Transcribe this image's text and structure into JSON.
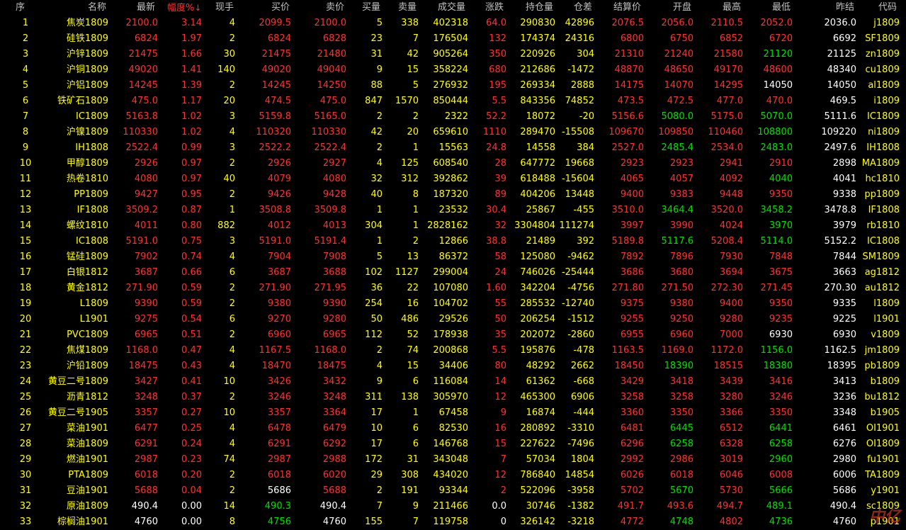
{
  "headers": {
    "seq": "序",
    "name": "名称",
    "latest": "最新",
    "change_pct": "幅度%",
    "sort_arrow": "↓",
    "cur_vol": "现手",
    "bid": "买价",
    "ask": "卖价",
    "bid_vol": "买量",
    "ask_vol": "卖量",
    "volume": "成交量",
    "change": "涨跌",
    "open_interest": "持仓量",
    "oi_change": "仓差",
    "settle": "结算价",
    "open": "开盘",
    "high": "最高",
    "low": "最低",
    "prev_settle": "昨结",
    "code": "代码"
  },
  "colors": {
    "up": "#ff3232",
    "down": "#00e000",
    "flat": "#ffffff",
    "text_yellow": "#ffff00"
  },
  "watermark": "中亿",
  "rows": [
    [
      "1",
      "焦炭1809",
      "2100.0",
      "3.14",
      "4",
      "2099.5",
      "2100.0",
      "5",
      "338",
      "402318",
      "64.0",
      "290830",
      "42896",
      "2076.5",
      "2056.0",
      "2110.5",
      "2052.0",
      "2036.0",
      "j1809"
    ],
    [
      "2",
      "硅铁1809",
      "6824",
      "1.97",
      "2",
      "6824",
      "6828",
      "23",
      "7",
      "176504",
      "132",
      "174374",
      "24316",
      "6800",
      "6750",
      "6852",
      "6720",
      "6692",
      "SF1809"
    ],
    [
      "3",
      "沪锌1809",
      "21475",
      "1.66",
      "30",
      "21475",
      "21480",
      "31",
      "42",
      "905264",
      "350",
      "220926",
      "304",
      "21310",
      "21240",
      "21580",
      "21120",
      "21125",
      "zn1809"
    ],
    [
      "4",
      "沪铜1809",
      "49020",
      "1.41",
      "140",
      "49020",
      "49040",
      "9",
      "15",
      "358224",
      "680",
      "212686",
      "-1472",
      "48870",
      "48650",
      "49170",
      "48600",
      "48340",
      "cu1809"
    ],
    [
      "5",
      "沪铝1809",
      "14245",
      "1.39",
      "2",
      "14245",
      "14250",
      "88",
      "5",
      "276932",
      "195",
      "269334",
      "2888",
      "14175",
      "14070",
      "14295",
      "14050",
      "14050",
      "al1809"
    ],
    [
      "6",
      "铁矿石1809",
      "475.0",
      "1.17",
      "20",
      "474.5",
      "475.0",
      "847",
      "1570",
      "850444",
      "5.5",
      "843356",
      "74852",
      "473.5",
      "472.5",
      "477.0",
      "470.0",
      "469.5",
      "i1809"
    ],
    [
      "7",
      "IC1809",
      "5163.8",
      "1.02",
      "3",
      "5159.8",
      "5165.0",
      "2",
      "2",
      "2322",
      "52.2",
      "18072",
      "-20",
      "5156.6",
      "5080.0",
      "5175.0",
      "5070.0",
      "5111.6",
      "IC1809"
    ],
    [
      "8",
      "沪镍1809",
      "110330",
      "1.02",
      "4",
      "110320",
      "110330",
      "42",
      "20",
      "659610",
      "1110",
      "289470",
      "-15508",
      "109670",
      "109850",
      "110460",
      "108800",
      "109220",
      "ni1809"
    ],
    [
      "9",
      "IH1808",
      "2522.4",
      "0.99",
      "3",
      "2522.2",
      "2522.4",
      "2",
      "1",
      "15563",
      "24.8",
      "14558",
      "384",
      "2527.0",
      "2485.4",
      "2534.0",
      "2483.0",
      "2497.6",
      "IH1808"
    ],
    [
      "10",
      "甲醇1809",
      "2926",
      "0.97",
      "2",
      "2926",
      "2927",
      "4",
      "125",
      "608540",
      "28",
      "647772",
      "19668",
      "2923",
      "2923",
      "2941",
      "2910",
      "2898",
      "MA1809"
    ],
    [
      "11",
      "热卷1810",
      "4080",
      "0.97",
      "40",
      "4079",
      "4080",
      "32",
      "312",
      "392862",
      "39",
      "618488",
      "-15604",
      "4065",
      "4057",
      "4092",
      "4040",
      "4041",
      "hc1810"
    ],
    [
      "12",
      "PP1809",
      "9427",
      "0.95",
      "2",
      "9426",
      "9428",
      "40",
      "8",
      "187320",
      "89",
      "404206",
      "13448",
      "9400",
      "9383",
      "9448",
      "9350",
      "9338",
      "pp1809"
    ],
    [
      "13",
      "IF1808",
      "3509.2",
      "0.87",
      "1",
      "3508.8",
      "3509.8",
      "1",
      "1",
      "23532",
      "30.4",
      "25867",
      "-455",
      "3510.0",
      "3464.4",
      "3520.0",
      "3458.2",
      "3478.8",
      "IF1808"
    ],
    [
      "14",
      "螺纹1810",
      "4011",
      "0.80",
      "882",
      "4012",
      "4013",
      "304",
      "1",
      "2828162",
      "32",
      "3304804",
      "111274",
      "3997",
      "3990",
      "4024",
      "3970",
      "3979",
      "rb1810"
    ],
    [
      "15",
      "IC1808",
      "5191.0",
      "0.75",
      "3",
      "5191.0",
      "5191.4",
      "1",
      "2",
      "12866",
      "38.8",
      "21489",
      "392",
      "5189.8",
      "5117.6",
      "5208.4",
      "5114.0",
      "5152.2",
      "IC1808"
    ],
    [
      "16",
      "锰硅1809",
      "7902",
      "0.74",
      "4",
      "7904",
      "7908",
      "5",
      "13",
      "86372",
      "58",
      "125080",
      "-9462",
      "7892",
      "7896",
      "7930",
      "7848",
      "7844",
      "SM1809"
    ],
    [
      "17",
      "白银1812",
      "3687",
      "0.66",
      "6",
      "3687",
      "3688",
      "102",
      "1127",
      "299004",
      "24",
      "746026",
      "-25444",
      "3686",
      "3680",
      "3694",
      "3675",
      "3663",
      "ag1812"
    ],
    [
      "18",
      "黄金1812",
      "271.90",
      "0.59",
      "2",
      "271.90",
      "271.95",
      "36",
      "22",
      "107080",
      "1.60",
      "342204",
      "-4756",
      "271.80",
      "271.50",
      "272.30",
      "271.45",
      "270.30",
      "au1812"
    ],
    [
      "19",
      "L1809",
      "9390",
      "0.59",
      "2",
      "9380",
      "9390",
      "254",
      "16",
      "104702",
      "55",
      "285532",
      "-12740",
      "9375",
      "9380",
      "9400",
      "9350",
      "9335",
      "l1809"
    ],
    [
      "20",
      "L1901",
      "9275",
      "0.54",
      "6",
      "9270",
      "9280",
      "50",
      "486",
      "29526",
      "50",
      "206254",
      "-1512",
      "9255",
      "9250",
      "9280",
      "9235",
      "9225",
      "l1901"
    ],
    [
      "21",
      "PVC1809",
      "6965",
      "0.51",
      "2",
      "6960",
      "6965",
      "112",
      "52",
      "178938",
      "35",
      "202072",
      "-2860",
      "6955",
      "6960",
      "7000",
      "6930",
      "6930",
      "v1809"
    ],
    [
      "22",
      "焦煤1809",
      "1168.0",
      "0.47",
      "4",
      "1167.5",
      "1168.0",
      "2",
      "74",
      "200868",
      "5.5",
      "195876",
      "-478",
      "1163.5",
      "1169.0",
      "1172.0",
      "1156.0",
      "1162.5",
      "jm1809"
    ],
    [
      "23",
      "沪铅1809",
      "18475",
      "0.43",
      "4",
      "18470",
      "18475",
      "4",
      "15",
      "34406",
      "80",
      "48292",
      "2662",
      "18450",
      "18390",
      "18515",
      "18380",
      "18395",
      "pb1809"
    ],
    [
      "24",
      "黄豆二号1809",
      "3427",
      "0.41",
      "10",
      "3426",
      "3432",
      "9",
      "6",
      "116084",
      "14",
      "61362",
      "-668",
      "3429",
      "3418",
      "3439",
      "3416",
      "3413",
      "b1809"
    ],
    [
      "25",
      "沥青1812",
      "3248",
      "0.37",
      "2",
      "3246",
      "3248",
      "311",
      "138",
      "305970",
      "12",
      "465300",
      "6906",
      "3258",
      "3258",
      "3280",
      "3246",
      "3236",
      "bu1812"
    ],
    [
      "26",
      "黄豆二号1905",
      "3357",
      "0.27",
      "10",
      "3357",
      "3364",
      "17",
      "1",
      "67458",
      "9",
      "16874",
      "-444",
      "3360",
      "3350",
      "3366",
      "3350",
      "3348",
      "b1905"
    ],
    [
      "27",
      "菜油1901",
      "6477",
      "0.25",
      "4",
      "6478",
      "6479",
      "10",
      "6",
      "82530",
      "16",
      "280892",
      "-3310",
      "6481",
      "6445",
      "6512",
      "6441",
      "6461",
      "OI1901"
    ],
    [
      "28",
      "菜油1809",
      "6291",
      "0.24",
      "4",
      "6291",
      "6292",
      "17",
      "6",
      "146768",
      "15",
      "227622",
      "-7496",
      "6296",
      "6258",
      "6328",
      "6258",
      "6276",
      "OI1809"
    ],
    [
      "29",
      "燃油1901",
      "2987",
      "0.23",
      "74",
      "2987",
      "2988",
      "172",
      "31",
      "343048",
      "7",
      "57034",
      "1804",
      "2992",
      "2986",
      "3019",
      "2960",
      "2980",
      "fu1901"
    ],
    [
      "30",
      "PTA1809",
      "6018",
      "0.20",
      "2",
      "6018",
      "6020",
      "29",
      "308",
      "434020",
      "12",
      "786840",
      "14854",
      "6026",
      "6018",
      "6046",
      "6008",
      "6006",
      "TA1809"
    ],
    [
      "31",
      "豆油1901",
      "5688",
      "0.04",
      "2",
      "5686",
      "5688",
      "2",
      "191",
      "93344",
      "2",
      "522096",
      "-3958",
      "5702",
      "5670",
      "5730",
      "5666",
      "5686",
      "y1901"
    ],
    [
      "32",
      "原油1809",
      "490.4",
      "0.00",
      "14",
      "490.3",
      "490.4",
      "7",
      "9",
      "211466",
      "0.0",
      "30746",
      "-1382",
      "491.7",
      "493.6",
      "494.7",
      "489.1",
      "490.4",
      "sc1809"
    ],
    [
      "33",
      "棕榈油1901",
      "4760",
      "0.00",
      "8",
      "4756",
      "4760",
      "155",
      "7",
      "119758",
      "0",
      "326142",
      "-3218",
      "4772",
      "4748",
      "4802",
      "4736",
      "4760",
      "p1901"
    ]
  ]
}
